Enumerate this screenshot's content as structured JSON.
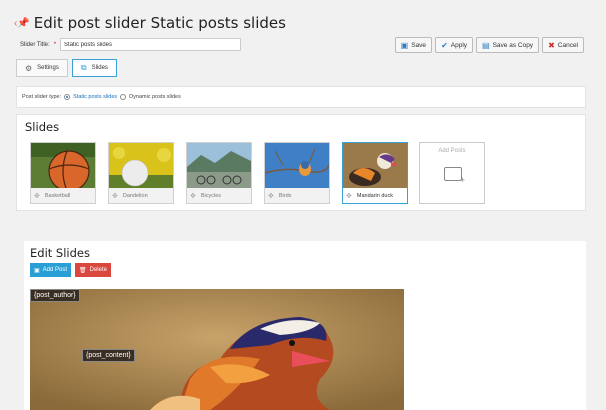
{
  "header": {
    "title": "Edit post slider Static posts slides"
  },
  "slider_title": {
    "label": "Slider Title:",
    "required_mark": "*",
    "value": "Static posts slides"
  },
  "toolbar": {
    "save": "Save",
    "apply": "Apply",
    "save_copy": "Save as Copy",
    "cancel": "Cancel"
  },
  "tabs": [
    {
      "label": "Settings"
    },
    {
      "label": "Slides"
    }
  ],
  "post_type": {
    "label": "Post slider type:",
    "option_static": "Static posts slides",
    "option_dynamic": "Dynamic posts slides",
    "selected": "Static posts slides"
  },
  "slides": {
    "title": "Slides",
    "items": [
      {
        "label": "Basketball"
      },
      {
        "label": "Dandelion"
      },
      {
        "label": "Bicycles"
      },
      {
        "label": "Birds"
      },
      {
        "label": "Mandarin duck"
      }
    ],
    "add_posts": "Add Posts"
  },
  "edit": {
    "title": "Edit Slides",
    "add_post": "Add Post",
    "delete": "Delete",
    "layer_author": "{post_author}",
    "layer_content": "{post_content}"
  },
  "colors": {
    "accent": "#2a9fd6",
    "danger": "#d9473e",
    "link": "#1e6fb8"
  }
}
